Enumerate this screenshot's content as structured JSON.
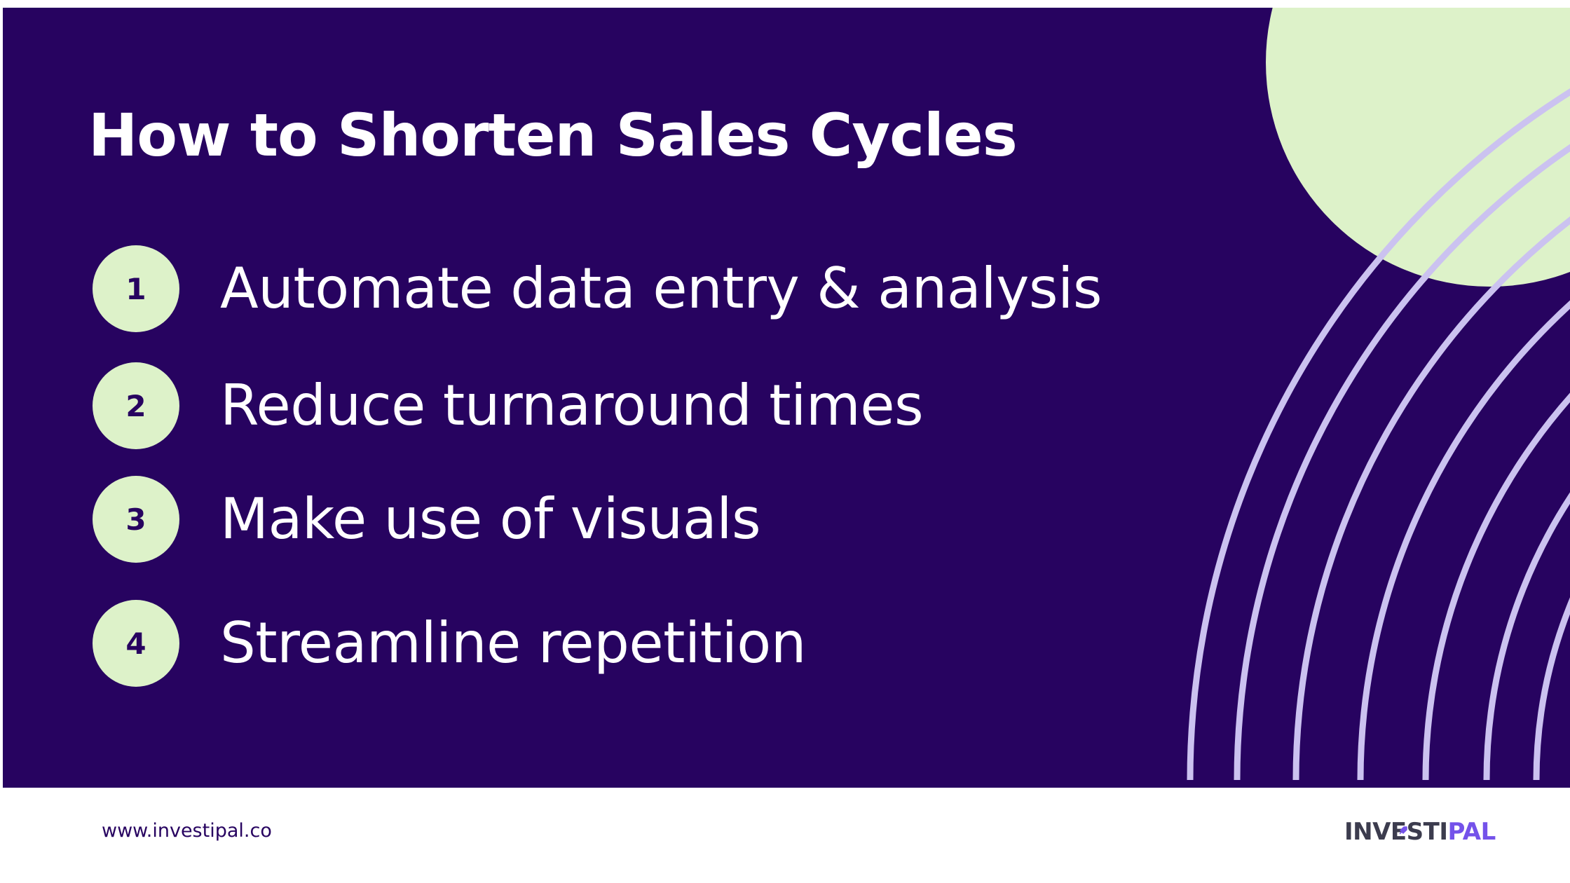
{
  "title": "How to Shorten Sales Cycles",
  "steps": [
    {
      "number": "1",
      "text": "Automate data entry & analysis"
    },
    {
      "number": "2",
      "text": "Reduce turnaround times"
    },
    {
      "number": "3",
      "text": "Make use of visuals"
    },
    {
      "number": "4",
      "text": "Streamline repetition"
    }
  ],
  "footer": {
    "url": "www.investipal.co"
  },
  "logo": {
    "part1": "INV",
    "part2": "ESTI",
    "part3": "PAL"
  },
  "colors": {
    "background": "#270360",
    "accent_green": "#ddf2c9",
    "arc_lines": "#cbc2f0",
    "logo_dark": "#3c3c4e",
    "logo_accent": "#7452ea"
  },
  "icons": {
    "logo_mark": "rocket-icon"
  }
}
